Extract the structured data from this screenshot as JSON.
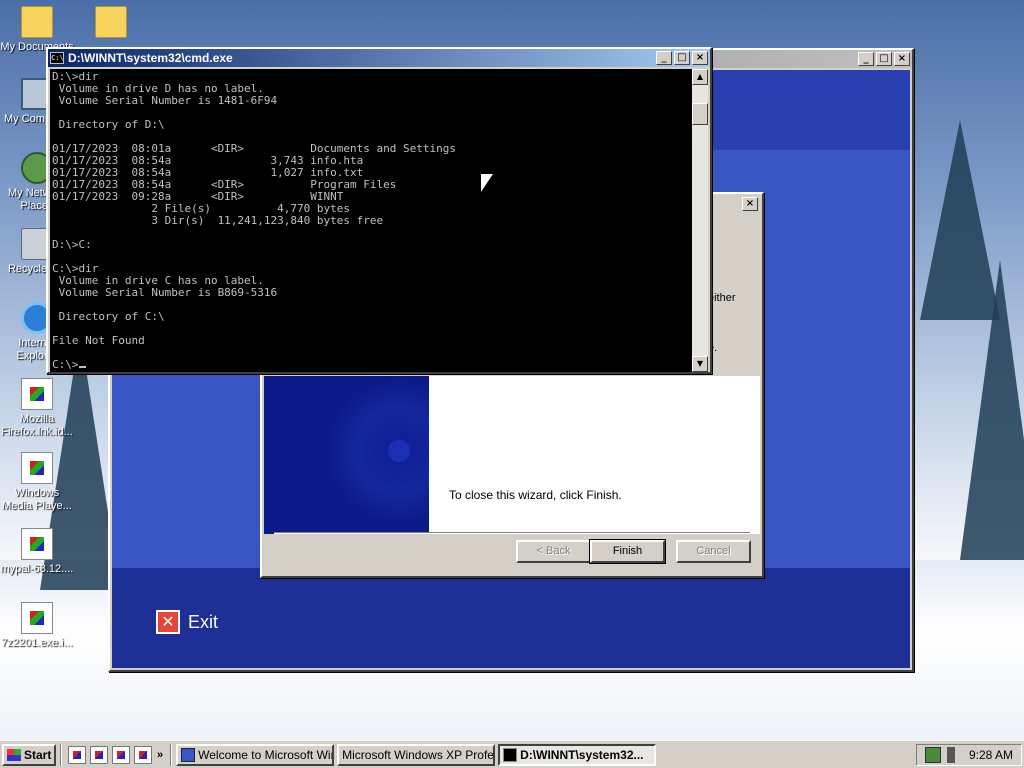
{
  "desktop": {
    "icons": [
      {
        "label": "My Documents",
        "icon": "folder-icon"
      },
      {
        "label": "",
        "icon": "folder-icon"
      },
      {
        "label": "My Computer",
        "icon": "computer-icon"
      },
      {
        "label": "My Network Places",
        "icon": "network-icon"
      },
      {
        "label": "Recycle Bin",
        "icon": "recycle-bin-icon"
      },
      {
        "label": "Internet Explorer",
        "icon": "internet-explorer-icon"
      },
      {
        "label": "Mozilla Firefox.lnk.id...",
        "icon": "file-icon"
      },
      {
        "label": "Windows Media Playe...",
        "icon": "file-icon"
      },
      {
        "label": "mypal-68.12....",
        "icon": "file-icon"
      },
      {
        "label": "7z2201.exe.i...",
        "icon": "file-icon"
      }
    ]
  },
  "setup_window": {
    "exit_label": "Exit"
  },
  "wizard": {
    "heading_fragment": "s",
    "text_fragment": "either",
    "text_fragment2": "e.",
    "close_text": "To close this wizard, click Finish.",
    "buttons": {
      "back": "< Back",
      "finish": "Finish",
      "cancel": "Cancel"
    }
  },
  "cmd": {
    "title": "D:\\WINNT\\system32\\cmd.exe",
    "output": "D:\\>dir\n Volume in drive D has no label.\n Volume Serial Number is 1481-6F94\n\n Directory of D:\\\n\n01/17/2023  08:01a      <DIR>          Documents and Settings\n01/17/2023  08:54a               3,743 info.hta\n01/17/2023  08:54a               1,027 info.txt\n01/17/2023  08:54a      <DIR>          Program Files\n01/17/2023  09:28a      <DIR>          WINNT\n               2 File(s)          4,770 bytes\n               3 Dir(s)  11,241,123,840 bytes free\n\nD:\\>C:\n\nC:\\>dir\n Volume in drive C has no label.\n Volume Serial Number is B869-5316\n\n Directory of C:\\\n\nFile Not Found\n\nC:\\>"
  },
  "taskbar": {
    "start_label": "Start",
    "more_label": "»",
    "tasks": [
      {
        "label": "Welcome to Microsoft Win...",
        "active": false
      },
      {
        "label": "Microsoft Windows XP Profess...",
        "active": false
      },
      {
        "label": "D:\\WINNT\\system32...",
        "active": true
      }
    ],
    "clock": "9:28 AM"
  },
  "colors": {
    "titlebar_active": "#0a246a",
    "titlebar_inactive": "#808080",
    "setup_blue": "#3a55c4",
    "console_text": "#c0c0c0"
  }
}
